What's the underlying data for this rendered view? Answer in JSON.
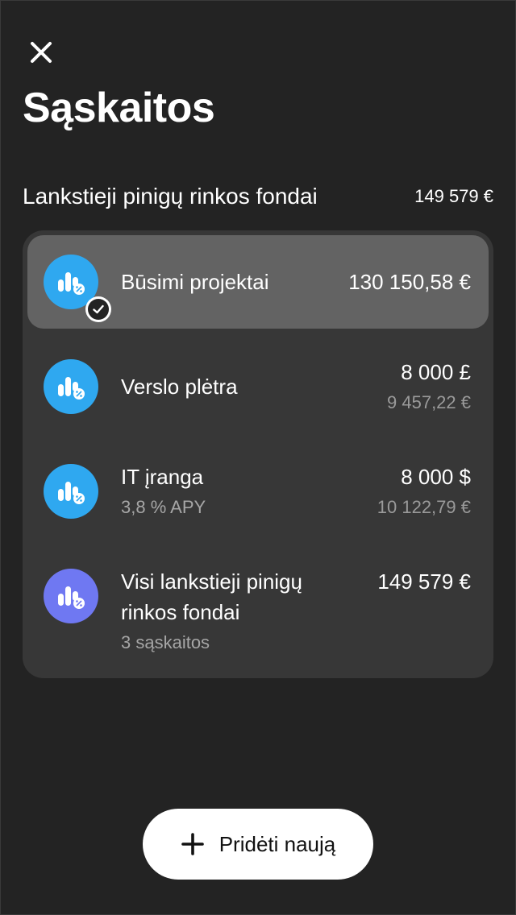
{
  "header": {
    "close_icon": "close-icon",
    "title": "Sąskaitos"
  },
  "section": {
    "title": "Lankstieji pinigų rinkos fondai",
    "total": "149 579 €"
  },
  "accounts": [
    {
      "name": "Būsimi projektai",
      "amount": "130 150,58 €",
      "icon": "money-market-fund-icon",
      "selected": true
    },
    {
      "name": "Verslo plėtra",
      "amount": "8 000 £",
      "amount_converted": "9 457,22 €",
      "icon": "money-market-fund-icon"
    },
    {
      "name": "IT įranga",
      "subtitle": "3,8 % APY",
      "amount": "8 000 $",
      "amount_converted": "10 122,79 €",
      "icon": "money-market-fund-icon"
    },
    {
      "name_line1": "Visi lankstieji pinigų",
      "name_line2": "rinkos fondai",
      "subtitle": "3 sąskaitos",
      "amount": "149 579 €",
      "icon": "money-market-fund-icon"
    }
  ],
  "add_button": {
    "label": "Pridėti naują",
    "icon": "plus-icon"
  },
  "colors": {
    "background": "#232323",
    "card": "#373737",
    "selected_row": "#636363",
    "icon_blue": "#2fa8f0",
    "icon_purple": "#6f78f2",
    "muted_text": "#a6a6a6"
  }
}
